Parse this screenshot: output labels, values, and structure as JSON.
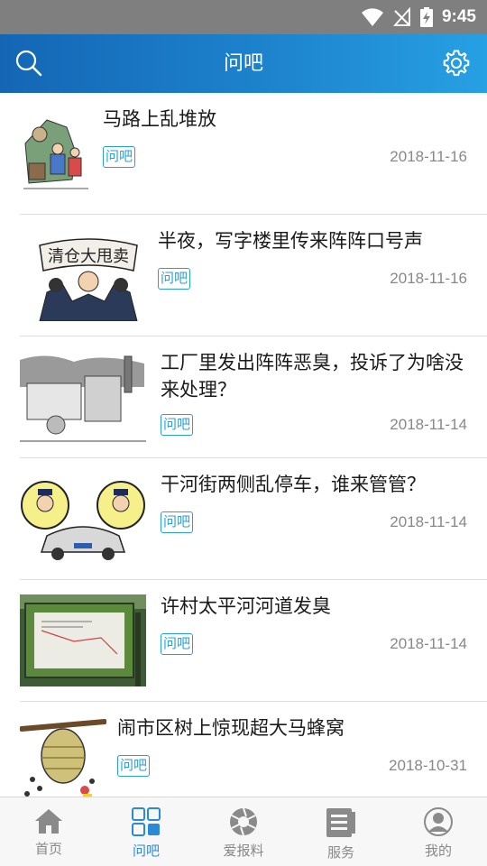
{
  "status_bar": {
    "time": "9:45"
  },
  "header": {
    "title": "问吧",
    "search_icon": "search-icon",
    "settings_icon": "gear-icon",
    "accent": "#1e86cf"
  },
  "feed": [
    {
      "title": "马路上乱堆放",
      "tag": "问吧",
      "date": "2018-11-16"
    },
    {
      "title": "半夜，写字楼里传来阵阵口号声",
      "tag": "问吧",
      "date": "2018-11-16",
      "thumb_caption": "清仓大甩卖"
    },
    {
      "title": "工厂里发出阵阵恶臭，投诉了为啥没来处理？",
      "tag": "问吧",
      "date": "2018-11-14"
    },
    {
      "title": "干河街两侧乱停车，谁来管管？",
      "tag": "问吧",
      "date": "2018-11-14"
    },
    {
      "title": "许村太平河河道发臭",
      "tag": "问吧",
      "date": "2018-11-14"
    },
    {
      "title": "闹市区树上惊现超大马蜂窝",
      "tag": "问吧",
      "date": "2018-10-31"
    }
  ],
  "tabs": [
    {
      "label": "首页",
      "icon": "home-icon",
      "active": false
    },
    {
      "label": "问吧",
      "icon": "grid-icon",
      "active": true
    },
    {
      "label": "爱报料",
      "icon": "aperture-icon",
      "active": false
    },
    {
      "label": "服务",
      "icon": "document-icon",
      "active": false
    },
    {
      "label": "我的",
      "icon": "user-icon",
      "active": false
    }
  ],
  "colors": {
    "active_tab": "#2a8ad8",
    "tag": "#2a9fd6",
    "inactive_tab": "#888888"
  }
}
